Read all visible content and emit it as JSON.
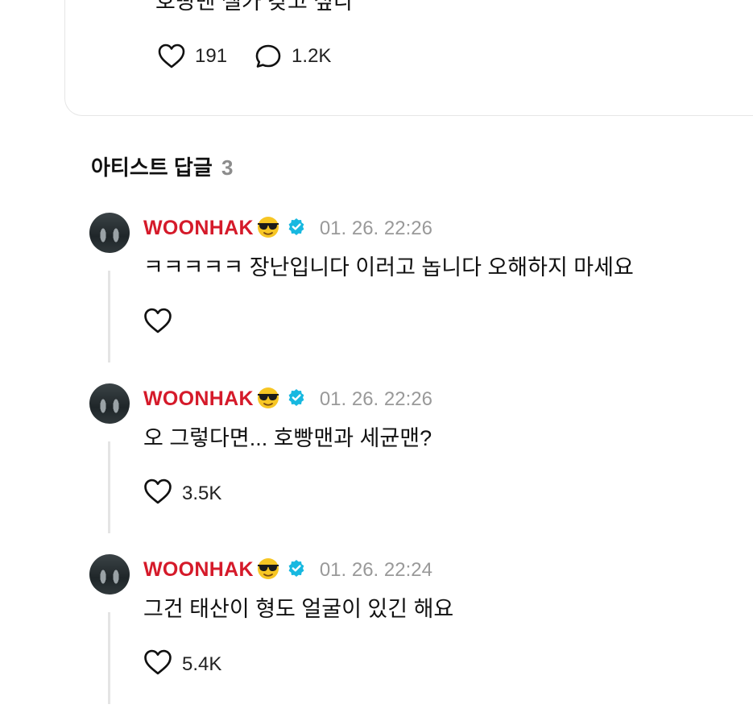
{
  "post": {
    "text": "호빵맨 셀카 갖고 싶다",
    "likes": "191",
    "comments": "1.2K"
  },
  "section": {
    "title": "아티스트 답글",
    "count": "3"
  },
  "replies": [
    {
      "author": "WOONHAK",
      "time": "01. 26. 22:26",
      "text": "ㅋㅋㅋㅋㅋ 장난입니다 이러고 놉니다 오해하지 마세요",
      "likes": ""
    },
    {
      "author": "WOONHAK",
      "time": "01. 26. 22:26",
      "text": "오 그렇다면... 호빵맨과 세균맨?",
      "likes": "3.5K"
    },
    {
      "author": "WOONHAK",
      "time": "01. 26. 22:24",
      "text": "그건 태산이 형도 얼굴이 있긴 해요",
      "likes": "5.4K"
    }
  ],
  "colors": {
    "author": "#d51a2a",
    "verified": "#17b8e0",
    "muted": "#999999"
  }
}
